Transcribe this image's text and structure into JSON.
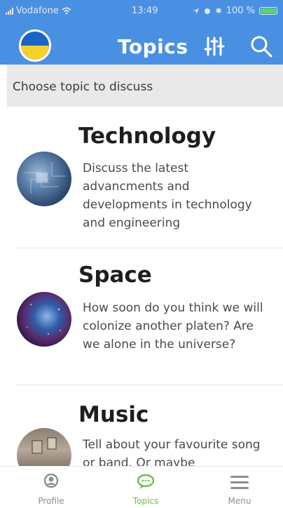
{
  "status_bar": {
    "carrier": "Vodafone",
    "time": "13:49",
    "battery": "100 %"
  },
  "header": {
    "title": "Topics",
    "avatar_colors": [
      "#1c63c7",
      "#f5d130"
    ],
    "accent": "#4a90e2"
  },
  "subheader": {
    "text": "Choose topic to discuss"
  },
  "topics": [
    {
      "name": "Technology",
      "description": "Discuss the latest advancments and developments in technology and engineering"
    },
    {
      "name": "Space",
      "description": "How soon do you think we will colonize another platen? Are we alone in the universe?"
    },
    {
      "name": "Music",
      "description": "Tell about your favourite song or band. Or maybe"
    }
  ],
  "tabbar": {
    "items": [
      {
        "label": "Profile",
        "icon": "person-icon",
        "active": false
      },
      {
        "label": "Topics",
        "icon": "chat-bubble-icon",
        "active": true
      },
      {
        "label": "Menu",
        "icon": "hamburger-menu-icon",
        "active": false
      }
    ],
    "active_color": "#6cc04a",
    "inactive_color": "#8e8e8e"
  }
}
